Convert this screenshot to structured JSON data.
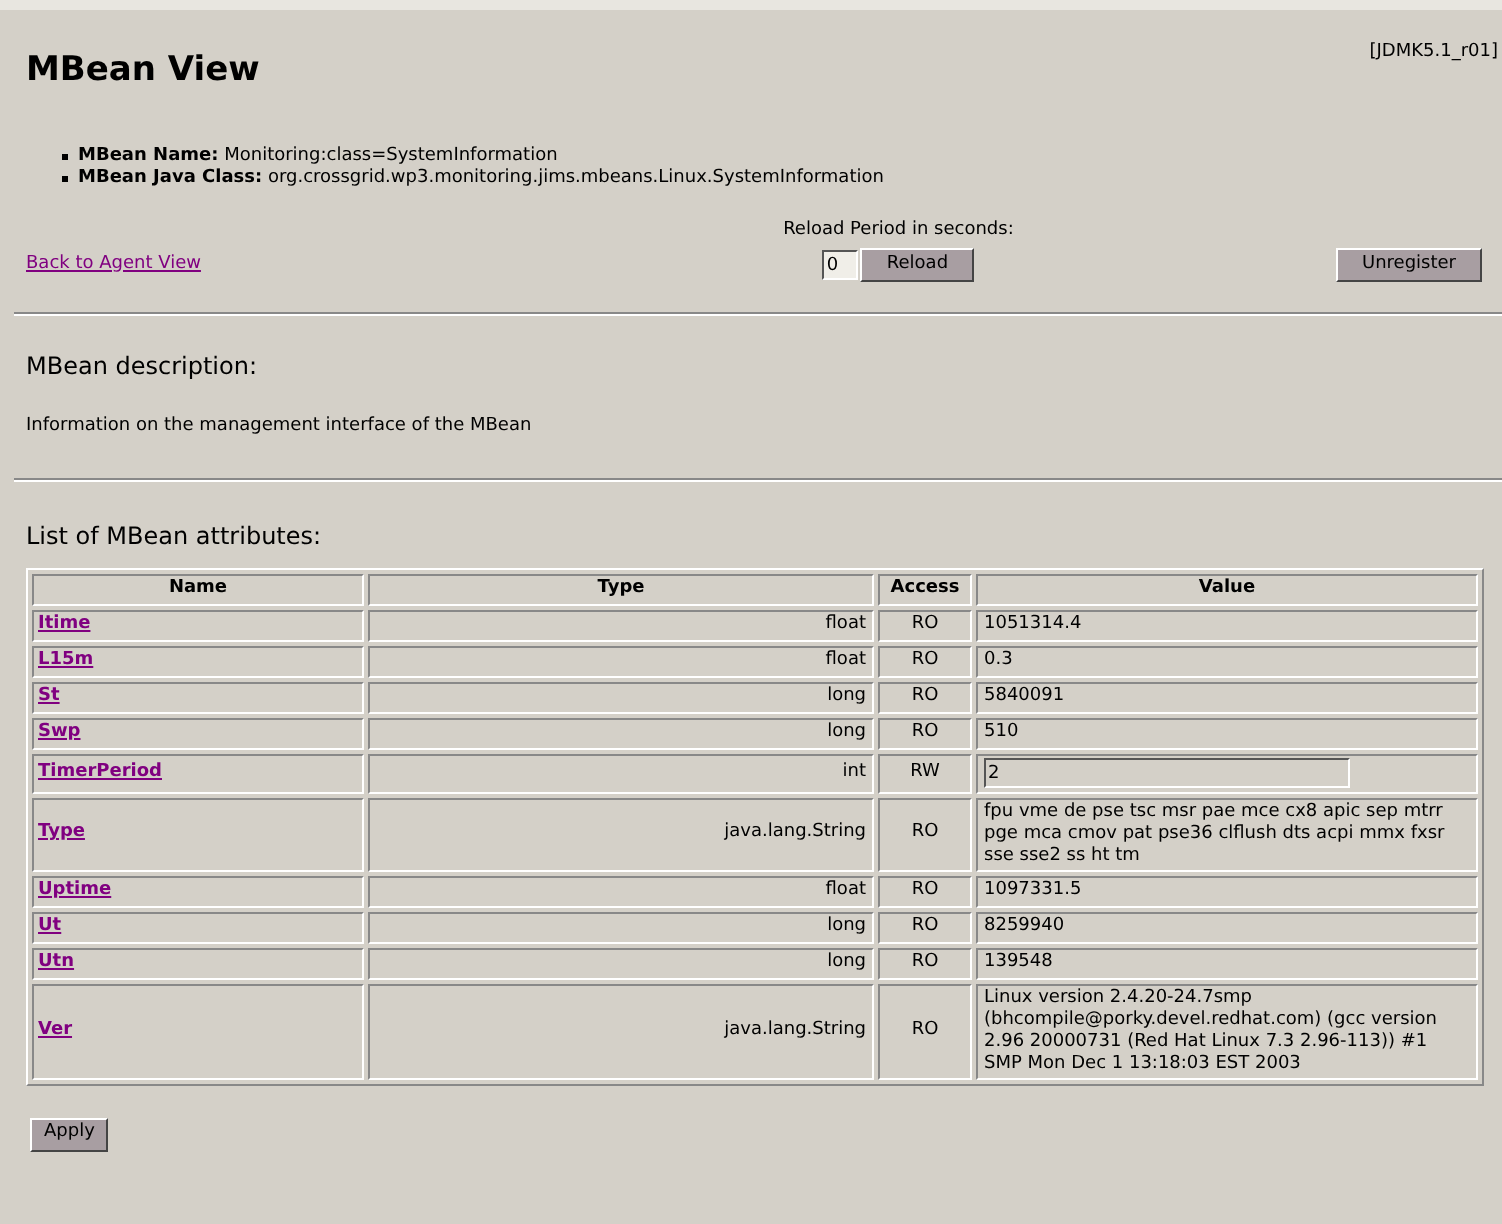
{
  "title": "MBean View",
  "version": "[JDMK5.1_r01]",
  "info": [
    {
      "label": "MBean Name:",
      "value": "Monitoring:class=SystemInformation"
    },
    {
      "label": "MBean Java Class:",
      "value": "org.crossgrid.wp3.monitoring.jims.mbeans.Linux.SystemInformation"
    }
  ],
  "back_link": "Back to Agent View",
  "reload": {
    "label": "Reload Period in seconds:",
    "value": "0",
    "button": "Reload"
  },
  "unregister_button": "Unregister",
  "description_heading": "MBean description:",
  "description": "Information on the management interface of the MBean",
  "attributes_heading": "List of MBean attributes:",
  "table": {
    "columns": [
      "Name",
      "Type",
      "Access",
      "Value"
    ],
    "rows": [
      {
        "name": "Itime",
        "type": "float",
        "access": "RO",
        "kind": "text",
        "value": "1051314.4"
      },
      {
        "name": "L15m",
        "type": "float",
        "access": "RO",
        "kind": "text",
        "value": "0.3"
      },
      {
        "name": "St",
        "type": "long",
        "access": "RO",
        "kind": "text",
        "value": "5840091"
      },
      {
        "name": "Swp",
        "type": "long",
        "access": "RO",
        "kind": "text",
        "value": "510"
      },
      {
        "name": "TimerPeriod",
        "type": "int",
        "access": "RW",
        "kind": "input",
        "value": "2"
      },
      {
        "name": "Type",
        "type": "java.lang.String",
        "access": "RO",
        "kind": "text",
        "value": "fpu vme de pse tsc msr pae mce cx8 apic sep mtrr pge mca cmov pat pse36 clflush dts acpi mmx fxsr sse sse2 ss ht tm"
      },
      {
        "name": "Uptime",
        "type": "float",
        "access": "RO",
        "kind": "text",
        "value": "1097331.5"
      },
      {
        "name": "Ut",
        "type": "long",
        "access": "RO",
        "kind": "text",
        "value": "8259940"
      },
      {
        "name": "Utn",
        "type": "long",
        "access": "RO",
        "kind": "text",
        "value": "139548"
      },
      {
        "name": "Ver",
        "type": "java.lang.String",
        "access": "RO",
        "kind": "text",
        "value": "Linux version 2.4.20-24.7smp (bhcompile@porky.devel.redhat.com) (gcc version 2.96 20000731 (Red Hat Linux 7.3 2.96-113)) #1 SMP Mon Dec 1 13:18:03 EST 2003"
      }
    ]
  },
  "apply_button": "Apply"
}
